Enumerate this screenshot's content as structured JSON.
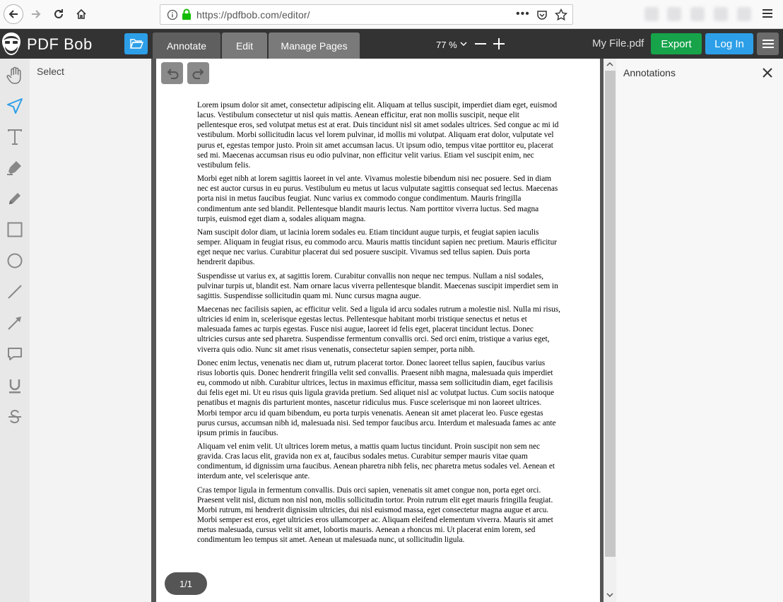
{
  "browser": {
    "url": "https://pdfbob.com/editor/",
    "more_glyph": "•••"
  },
  "app": {
    "brand": "PDF Bob",
    "tabs": [
      {
        "label": "Annotate",
        "active": true
      },
      {
        "label": "Edit",
        "active": false
      },
      {
        "label": "Manage Pages",
        "active": false
      }
    ],
    "zoom": "77 %",
    "file_name": "My File.pdf",
    "export_label": "Export",
    "login_label": "Log In",
    "colors": {
      "header": "#333333",
      "export": "#16a34a",
      "accent": "#2d9fe8",
      "active_tool": "#2d9fe8"
    }
  },
  "toolbar": {
    "selected_tool": "Select",
    "tools": [
      "hand-icon",
      "select-arrow-icon",
      "text-icon",
      "highlighter-icon",
      "pencil-icon",
      "rectangle-icon",
      "circle-icon",
      "line-icon",
      "arrow-icon",
      "comment-icon",
      "underline-icon",
      "strikethrough-icon"
    ]
  },
  "document": {
    "paragraphs": [
      "Lorem ipsum dolor sit amet, consectetur adipiscing elit. Aliquam at tellus suscipit, imperdiet diam eget, euismod lacus. Vestibulum consectetur ut nisl quis mattis. Aenean efficitur, erat non mollis suscipit, neque elit pellentesque eros, sed volutpat metus est at erat. Duis tincidunt nisl sit amet sodales ultrices. Sed congue ac mi id vestibulum. Morbi sollicitudin lacus vel lorem pulvinar, id mollis mi volutpat. Aliquam erat dolor, vulputate vel purus et, egestas tempor justo. Proin sit amet accumsan lacus. Ut ipsum odio, tempus vitae porttitor eu, placerat sed mi. Maecenas accumsan risus eu odio pulvinar, non efficitur velit varius. Etiam vel suscipit enim, nec vestibulum felis.",
      "Morbi eget nibh at lorem sagittis laoreet in vel ante. Vivamus molestie bibendum nisi nec posuere. Sed in diam nec est auctor cursus in eu purus. Vestibulum eu metus ut lacus vulputate sagittis consequat sed lectus. Maecenas porta nisi in metus faucibus feugiat. Nunc varius ex commodo congue condimentum. Mauris fringilla condimentum ante sed blandit. Pellentesque blandit mauris lectus. Nam porttitor viverra luctus. Sed magna turpis, euismod eget diam a, sodales aliquam magna.",
      "Nam suscipit dolor diam, ut lacinia lorem sodales eu. Etiam tincidunt augue turpis, et feugiat sapien iaculis semper. Aliquam in feugiat risus, eu commodo arcu. Mauris mattis tincidunt sapien nec pretium. Mauris efficitur eget neque nec varius. Curabitur placerat dui sed posuere suscipit. Vivamus sed tellus sapien. Duis porta hendrerit dapibus.",
      "Suspendisse ut varius ex, at sagittis lorem. Curabitur convallis non neque nec tempus. Nullam a nisl sodales, pulvinar turpis ut, blandit est. Nam ornare lacus viverra pellentesque blandit. Maecenas suscipit imperdiet sem in sagittis. Suspendisse sollicitudin quam mi. Nunc cursus magna augue.",
      "Maecenas nec facilisis sapien, ac efficitur velit. Sed a ligula id arcu sodales rutrum a molestie nisl. Nulla mi risus, ultricies id enim in, scelerisque egestas lectus. Pellentesque habitant morbi tristique senectus et netus et malesuada fames ac turpis egestas. Fusce nisi augue, laoreet id felis eget, placerat tincidunt lectus. Donec ultricies cursus ante sed pharetra. Suspendisse fermentum convallis orci. Sed orci enim, tristique a varius eget, viverra quis odio. Nunc sit amet risus venenatis, consectetur sapien semper, porta nibh.",
      "Donec enim lectus, venenatis nec diam ut, rutrum placerat tortor. Donec laoreet tellus sapien, faucibus varius risus lobortis quis. Donec hendrerit fringilla velit sed convallis. Praesent nibh magna, malesuada quis imperdiet eu, commodo ut nibh. Curabitur ultrices, lectus in maximus efficitur, massa sem sollicitudin diam, eget facilisis dui felis eget mi. Ut eu risus quis ligula gravida pretium. Sed aliquet nisl ac volutpat luctus. Cum sociis natoque penatibus et magnis dis parturient montes, nascetur ridiculus mus. Fusce scelerisque mi non laoreet ultrices. Morbi tempor arcu id quam bibendum, eu porta turpis venenatis. Aenean sit amet placerat leo. Fusce egestas purus cursus, accumsan nibh id, malesuada nisi. Sed tempor faucibus arcu. Interdum et malesuada fames ac ante ipsum primis in faucibus.",
      "Aliquam vel enim velit. Ut ultrices lorem metus, a mattis quam luctus tincidunt. Proin suscipit non sem nec gravida. Cras lacus elit, gravida non ex at, faucibus sodales metus. Curabitur semper mauris vitae quam condimentum, id dignissim urna faucibus. Aenean pharetra nibh felis, nec pharetra metus sodales vel. Aenean et interdum ante, vel scelerisque ante.",
      "Cras tempor ligula in fermentum convallis. Duis orci sapien, venenatis sit amet congue non, porta eget orci. Praesent velit nisl, dictum non nisl non, mollis sollicitudin tortor. Proin rutrum elit eget mauris fringilla feugiat. Morbi rutrum, mi hendrerit dignissim ultricies, dui nisl euismod massa, eget consectetur magna augue et arcu. Morbi semper est eros, eget ultricies eros ullamcorper ac. Aliquam eleifend elementum viverra. Mauris sit amet metus malesuada, cursus velit sit amet, lobortis mauris. Aenean a rhoncus mi. Ut placerat enim lorem, sed condimentum leo tempus sit amet. Aenean ut malesuada nunc, ut sollicitudin ligula."
    ],
    "page_indicator": "1/1"
  },
  "annotations_panel": {
    "title": "Annotations"
  }
}
